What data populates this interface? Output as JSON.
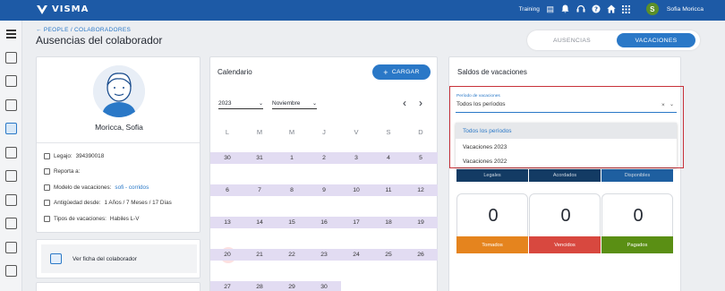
{
  "topbar": {
    "brand": "VISMA",
    "env": "Training",
    "user_initial": "S",
    "user_name": "Sofia Moricca",
    "icons": [
      "calendar-icon",
      "bell-icon",
      "headset-icon",
      "help-icon",
      "home-icon",
      "apps-grid-icon"
    ]
  },
  "breadcrumb": {
    "text": "PEOPLE / COLABORADORES"
  },
  "page": {
    "title": "Ausencias del colaborador"
  },
  "tabs": [
    {
      "label": "AUSENCIAS",
      "active": false
    },
    {
      "label": "VACACIONES",
      "active": true
    }
  ],
  "profile": {
    "name": "Moricca, Sofia",
    "rows": [
      {
        "icon": "id-card-icon",
        "label": "Legajo:",
        "value": "394390018",
        "link": false
      },
      {
        "icon": "users-icon",
        "label": "Reporta a:",
        "value": "",
        "link": false
      },
      {
        "icon": "list-icon",
        "label": "Modelo de vacaciones:",
        "value": "sofi - corridos",
        "link": true
      },
      {
        "icon": "calendar-icon",
        "label": "Antigüedad desde:",
        "value": "1 Años / 7 Meses / 17 Días",
        "link": false
      },
      {
        "icon": "list-icon",
        "label": "Tipos de vacaciones:",
        "value": "Habiles L-V",
        "link": false
      }
    ],
    "ficha_label": "Ver ficha del colaborador"
  },
  "calendar": {
    "title": "Calendario",
    "cargar_label": "CARGAR",
    "year": "2023",
    "month": "Noviembre",
    "day_headers": [
      "L",
      "M",
      "M",
      "J",
      "V",
      "S",
      "D"
    ],
    "weeks": [
      [
        "30",
        "31",
        "1",
        "2",
        "3",
        "4",
        "5"
      ],
      [
        "6",
        "7",
        "8",
        "9",
        "10",
        "11",
        "12"
      ],
      [
        "13",
        "14",
        "15",
        "16",
        "17",
        "18",
        "19"
      ],
      [
        "20",
        "21",
        "22",
        "23",
        "24",
        "25",
        "26"
      ],
      [
        "27",
        "28",
        "29",
        "30",
        "",
        "",
        ""
      ]
    ],
    "today": "20"
  },
  "saldos": {
    "title": "Saldos de vacaciones",
    "field_label": "Período de vacaciones",
    "field_value": "Todos los períodos",
    "options": [
      "Todos los períodos",
      "Vacaciones 2023",
      "Vacaciones 2022"
    ],
    "hidden_headers": [
      "Legales",
      "Acordados",
      "Disponibles"
    ],
    "stats": [
      {
        "value": "0",
        "label": "Tomados",
        "color": "#e5841e"
      },
      {
        "value": "0",
        "label": "Vencidos",
        "color": "#d8483f"
      },
      {
        "value": "0",
        "label": "Pagados",
        "color": "#5a8f14"
      }
    ]
  }
}
